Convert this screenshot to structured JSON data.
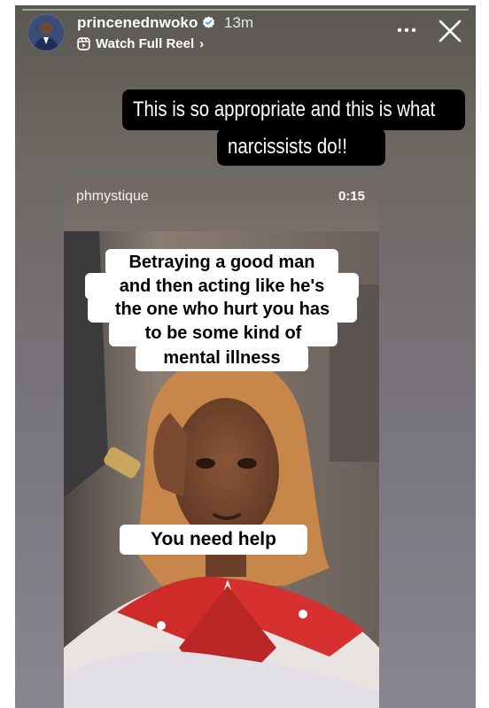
{
  "story": {
    "username": "princenednwoko",
    "time_ago": "13m",
    "reel_link_label": "Watch Full Reel",
    "reel_link_chevron": "›",
    "icons": {
      "avatar": "profile-photo",
      "verified": "verified-badge-icon",
      "reel": "reels-icon",
      "more": "more-options-icon",
      "close": "close-icon"
    },
    "caption": {
      "line1": "This is so appropriate and this is what",
      "line2": "narcissists  do!!"
    }
  },
  "reel": {
    "username": "phmystique",
    "duration": "0:15",
    "overlay_lines": [
      "Betraying a good man",
      "and then acting like he's",
      "the one who hurt you has",
      "to be some kind of",
      "mental illness"
    ],
    "bottom_text": "You need help"
  }
}
